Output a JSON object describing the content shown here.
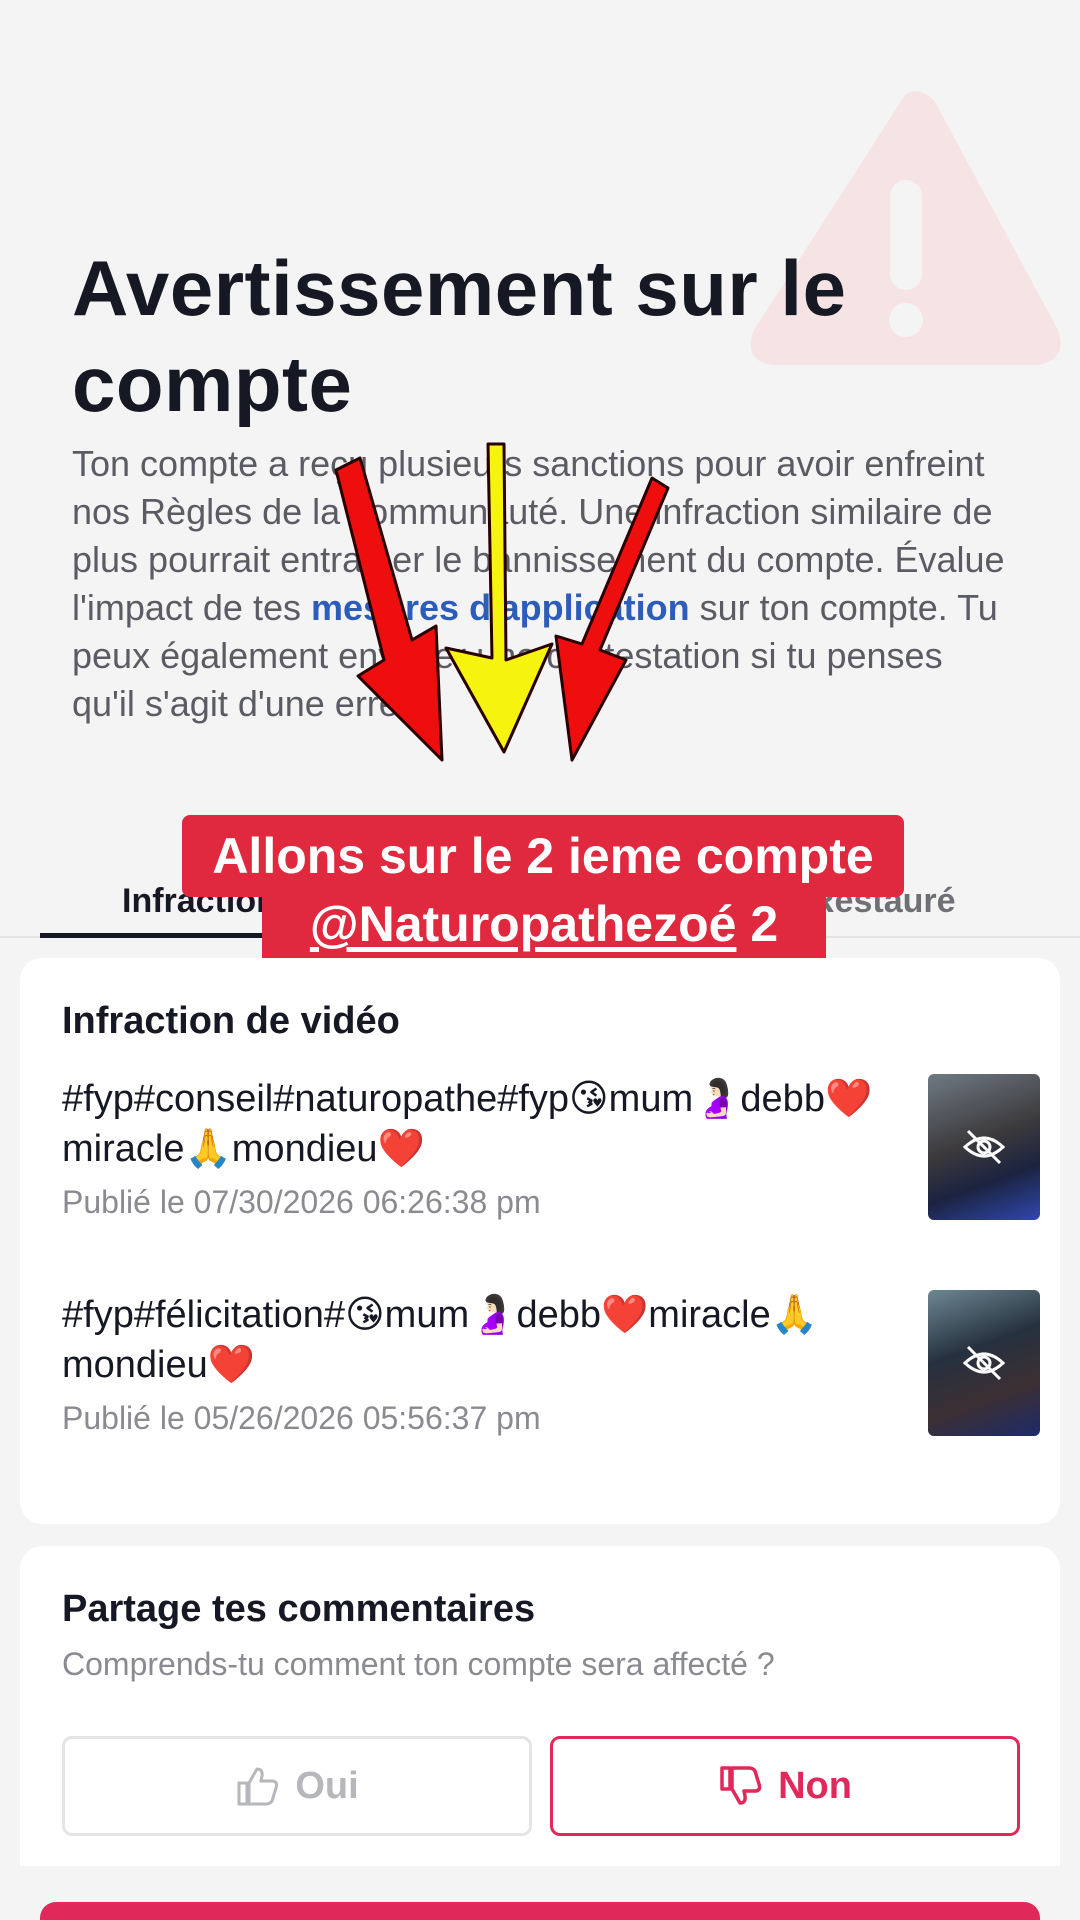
{
  "header": {
    "title": "Avertissement sur le compte",
    "description_before_link": "Ton compte a reçu plusieurs sanctions pour avoir enfreint nos Règles de la communauté. Une infraction similaire de plus pourrait entraîner le bannissement du compte. Évalue l'impact de tes ",
    "description_link": "mesures d'application",
    "description_after_link": " sur ton compte. Tu peux également envoyer une contestation si tu penses qu'il s'agit d'une erreur."
  },
  "tabs": [
    {
      "label": "Infraction"
    },
    {
      "label": "Restauré"
    }
  ],
  "caption": {
    "line1": "Allons sur le 2 ieme compte",
    "handle": "@Naturopathezoé",
    "line2_suffix": " 2"
  },
  "violations": {
    "title": "Infraction de vidéo",
    "items": [
      {
        "text": "#fyp#conseil#naturopathe#fyp😘mum🤰🏻debb❤️miracle🙏mondieu❤️",
        "date": "Publié le 07/30/2026 06:26:38 pm"
      },
      {
        "text": "#fyp#félicitation#😘mum🤰🏻debb❤️miracle🙏mondieu❤️",
        "date": "Publié le 05/26/2026 05:56:37 pm"
      }
    ]
  },
  "feedback": {
    "title": "Partage tes commentaires",
    "question": "Comprends-tu comment ton compte sera affecté ?",
    "yes_label": "Oui",
    "no_label": "Non"
  },
  "colors": {
    "accent": "#e0295a",
    "caption_bg": "#e0293f",
    "link": "#2b5db9",
    "warning_tint": "#f6dfe1"
  },
  "icons": [
    "warning-triangle-icon",
    "hidden-eye-icon",
    "thumbs-up-icon",
    "thumbs-down-icon"
  ]
}
